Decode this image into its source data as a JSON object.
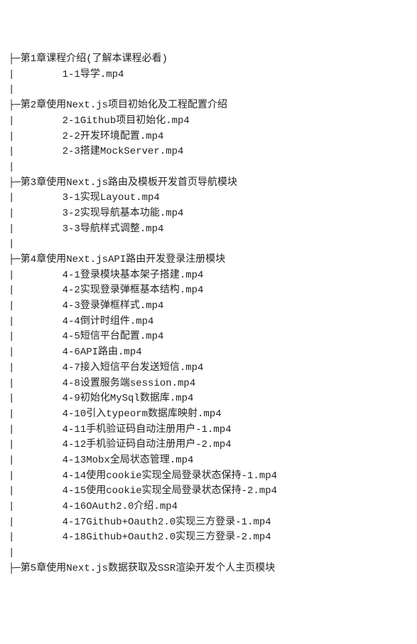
{
  "chapters": [
    {
      "title": "第1章课程介绍(了解本课程必看)",
      "items": [
        "1-1导学.mp4"
      ]
    },
    {
      "title": "第2章使用Next.js项目初始化及工程配置介绍",
      "items": [
        "2-1Github项目初始化.mp4",
        "2-2开发环境配置.mp4",
        "2-3搭建MockServer.mp4"
      ]
    },
    {
      "title": "第3章使用Next.js路由及模板开发首页导航模块",
      "items": [
        "3-1实现Layout.mp4",
        "3-2实现导航基本功能.mp4",
        "3-3导航样式调整.mp4"
      ]
    },
    {
      "title": "第4章使用Next.jsAPI路由开发登录注册模块",
      "items": [
        "4-1登录模块基本架子搭建.mp4",
        "4-2实现登录弹框基本结构.mp4",
        "4-3登录弹框样式.mp4",
        "4-4倒计时组件.mp4",
        "4-5短信平台配置.mp4",
        "4-6API路由.mp4",
        "4-7接入短信平台发送短信.mp4",
        "4-8设置服务端session.mp4",
        "4-9初始化MySql数据库.mp4",
        "4-10引入typeorm数据库映射.mp4",
        "4-11手机验证码自动注册用户-1.mp4",
        "4-12手机验证码自动注册用户-2.mp4",
        "4-13Mobx全局状态管理.mp4",
        "4-14使用cookie实现全局登录状态保持-1.mp4",
        "4-15使用cookie实现全局登录状态保持-2.mp4",
        "4-16OAuth2.0介绍.mp4",
        "4-17Github+Oauth2.0实现三方登录-1.mp4",
        "4-18Github+Oauth2.0实现三方登录-2.mp4"
      ]
    },
    {
      "title": "第5章使用Next.js数据获取及SSR渲染开发个人主页模块",
      "items": []
    }
  ],
  "glyphs": {
    "branch": "├─",
    "pipe": "|",
    "indent": "        "
  }
}
